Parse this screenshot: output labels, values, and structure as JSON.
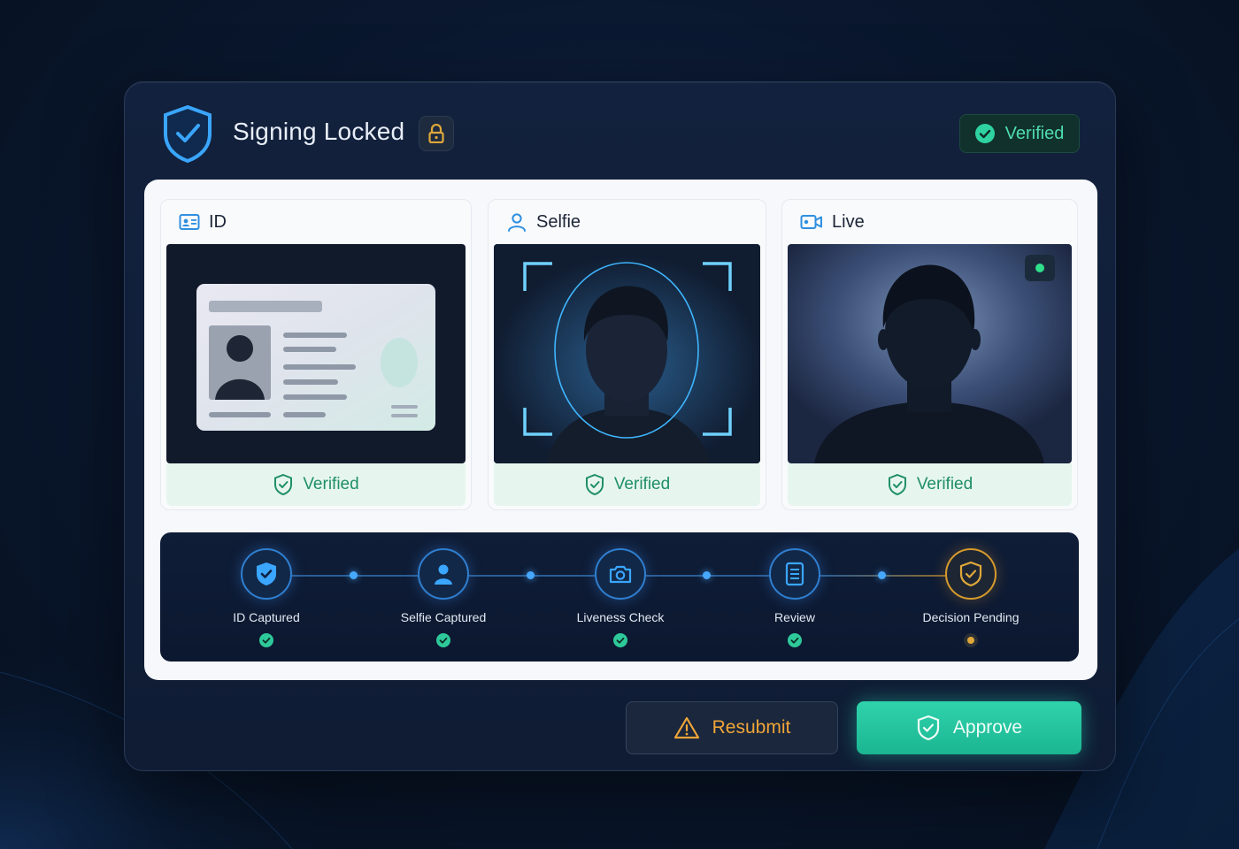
{
  "header": {
    "title": "Signing Locked",
    "status_label": "Verified"
  },
  "cards": [
    {
      "title": "ID",
      "icon": "id-card-icon",
      "status": "Verified"
    },
    {
      "title": "Selfie",
      "icon": "user-icon",
      "status": "Verified"
    },
    {
      "title": "Live",
      "icon": "video-camera-icon",
      "status": "Verified"
    }
  ],
  "steps": [
    {
      "label": "ID Captured",
      "icon": "shield-check-icon",
      "state": "complete"
    },
    {
      "label": "Selfie Captured",
      "icon": "user-icon",
      "state": "complete"
    },
    {
      "label": "Liveness Check",
      "icon": "camera-icon",
      "state": "complete"
    },
    {
      "label": "Review",
      "icon": "document-icon",
      "state": "complete"
    },
    {
      "label": "Decision Pending",
      "icon": "shield-check-icon",
      "state": "pending"
    }
  ],
  "actions": {
    "resubmit_label": "Resubmit",
    "approve_label": "Approve"
  },
  "colors": {
    "accent_blue": "#3aa6ff",
    "success_green": "#2ec99a",
    "warning_amber": "#f0a538"
  }
}
